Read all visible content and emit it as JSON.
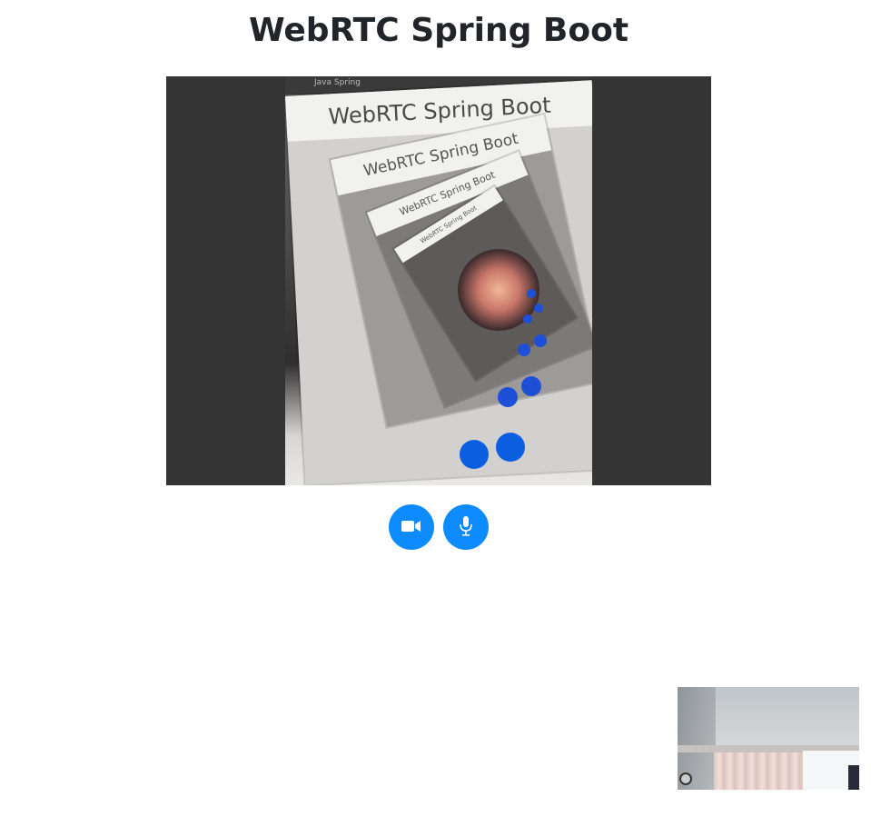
{
  "page": {
    "title": "WebRTC Spring Boot"
  },
  "remote_video": {
    "embedded_titles": [
      "WebRTC Spring Boot",
      "WebRTC Spring Boot",
      "WebRTC Spring Boot",
      "WebRTC Spring Boot"
    ],
    "phone_status_text": "Java Spring"
  },
  "controls": {
    "camera_icon": "video-camera-icon",
    "mic_icon": "microphone-icon",
    "button_color": "#0d8bff"
  },
  "colors": {
    "background": "#ffffff",
    "video_background": "#343434",
    "title_text": "#212529"
  }
}
